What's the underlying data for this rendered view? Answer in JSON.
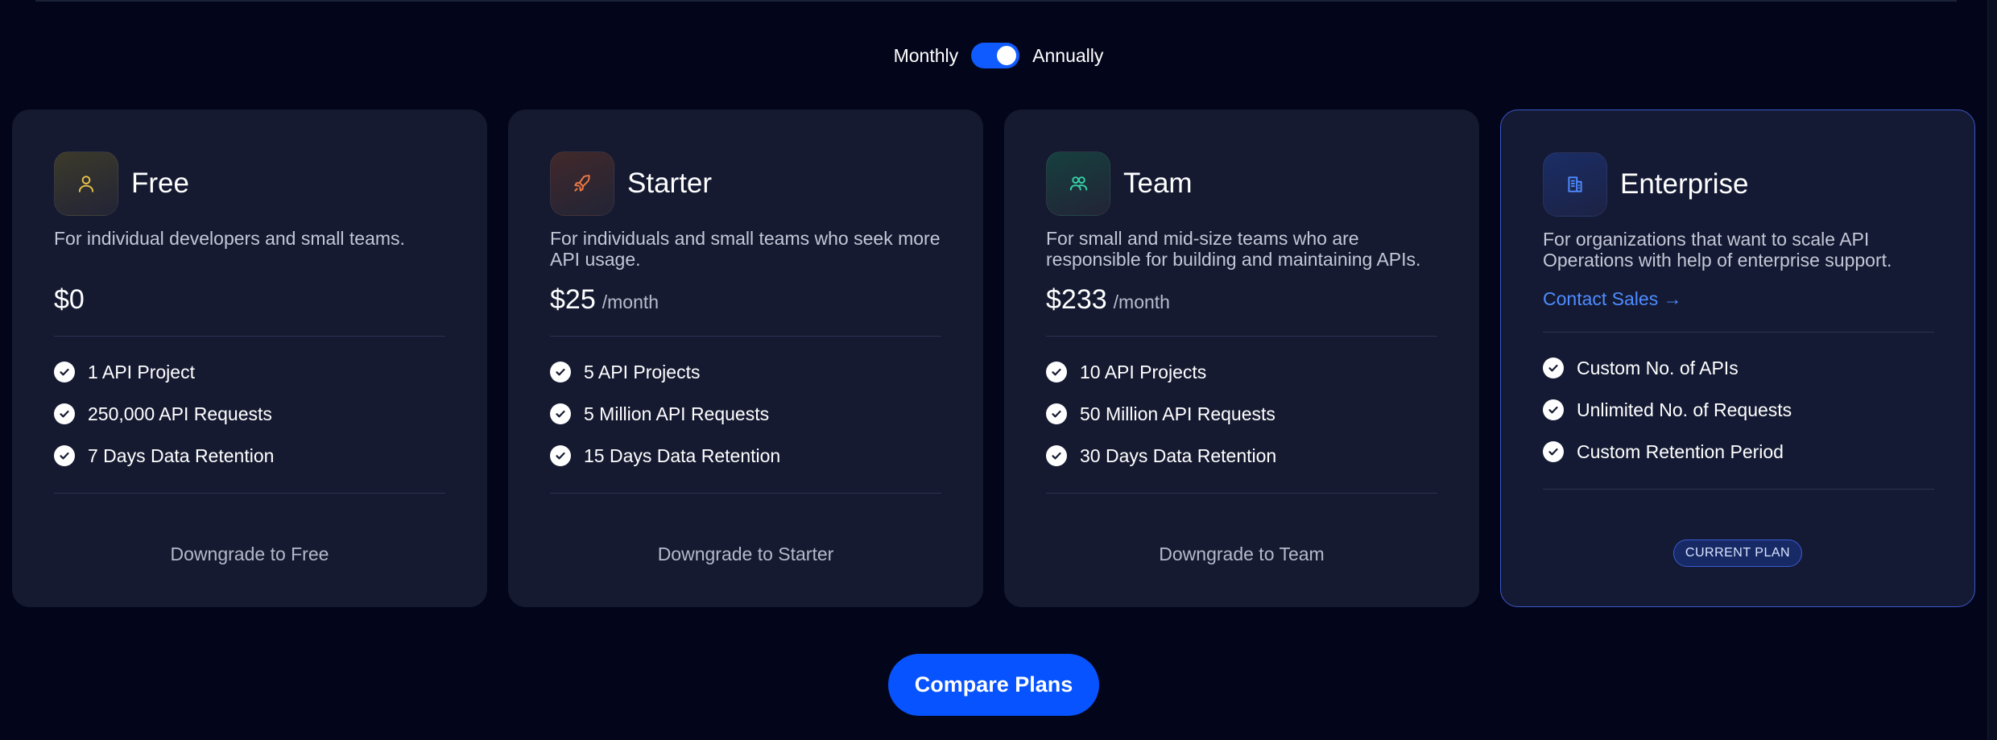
{
  "billing": {
    "monthly_label": "Monthly",
    "annually_label": "Annually",
    "selected": "Annually"
  },
  "plans": [
    {
      "name": "Free",
      "icon": "user-icon",
      "description": "For individual developers and small teams.",
      "price": "$0",
      "period": "",
      "features": [
        "1 API Project",
        "250,000 API Requests",
        "7 Days Data Retention"
      ],
      "action": "Downgrade to Free"
    },
    {
      "name": "Starter",
      "icon": "rocket-icon",
      "description": "For individuals and small teams who seek more API usage.",
      "price": "$25",
      "period": "/month",
      "features": [
        "5 API Projects",
        "5 Million API Requests",
        "15 Days Data Retention"
      ],
      "action": "Downgrade to Starter"
    },
    {
      "name": "Team",
      "icon": "users-icon",
      "description": "For small and mid-size teams who are responsible for building and maintaining APIs.",
      "price": "$233",
      "period": "/month",
      "features": [
        "10 API Projects",
        "50 Million API Requests",
        "30 Days Data Retention"
      ],
      "action": "Downgrade to Team"
    },
    {
      "name": "Enterprise",
      "icon": "building-icon",
      "description": "For organizations that want to scale API Operations with help of enterprise support.",
      "contact_label": "Contact Sales →",
      "features": [
        "Custom No. of APIs",
        "Unlimited No. of Requests",
        "Custom Retention Period"
      ],
      "badge": "CURRENT PLAN"
    }
  ],
  "compare_button": "Compare Plans",
  "colors": {
    "background": "#03061a",
    "card": "#151a31",
    "accent": "#0753ff",
    "link": "#4f8cff",
    "free_icon": "#e8c24a",
    "starter_icon": "#f07a45",
    "team_icon": "#37d1a8",
    "enterprise_icon": "#4f8cff"
  }
}
